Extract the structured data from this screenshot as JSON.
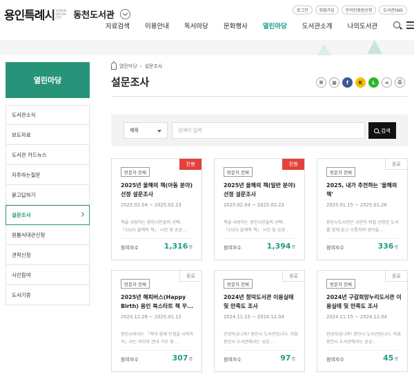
{
  "header": {
    "logo_main": "용인특례시",
    "logo_sub": "YONGIN SPECIAL CITY",
    "library": "동천도서관",
    "util": [
      "로그인",
      "회원가입",
      "온라인회원신청",
      "도서관SNS"
    ],
    "nav": [
      "자료검색",
      "이용안내",
      "독서마당",
      "문화행사",
      "열린마당",
      "도서관소개",
      "나의도서관"
    ],
    "nav_active_index": 4
  },
  "sidebar": {
    "title": "열린마당",
    "items": [
      "도서관소식",
      "보도자료",
      "도서관 카드뉴스",
      "자주하는질문",
      "묻고답하기",
      "설문조사",
      "원룸식대관신청",
      "견학신청",
      "시민참여",
      "도서기증"
    ],
    "active_index": 5
  },
  "breadcrumb": [
    "열린마당",
    "설문조사"
  ],
  "page_title": "설문조사",
  "share": [
    "link-icon",
    "qr-icon",
    "facebook-icon",
    "kakaostory-icon",
    "line-icon",
    "share-icon",
    "print-icon"
  ],
  "search": {
    "select_value": "제목",
    "placeholder": "검색어 입력",
    "button": "검색"
  },
  "cards": [
    {
      "status": "진행",
      "tag": "방문자 전체",
      "title": "2025년 올해의 책(아동 분야) 선정 설문조사",
      "date": "2025.02.04 ~ 2025.02.23",
      "desc": "책을 사랑하는 용인시민들의 선택, 「2025 올해의 책」 시민 및 공공...",
      "part_label": "참여자수",
      "count": "1,316",
      "unit": "명"
    },
    {
      "status": "진행",
      "tag": "방문자 전체",
      "title": "2025년 올해의 책(일반 분야) 선정 설문조사",
      "date": "2025.02.04 ~ 2025.02.23",
      "desc": "책을 사랑하는 용인시민들의 선택, 「2025 올해의 책」 시민 및 공공...",
      "part_label": "참여자수",
      "count": "1,394",
      "unit": "명"
    },
    {
      "status": "종료",
      "tag": "방문자 전체",
      "title": "2025, 내가 추천하는 '올해의 책'",
      "date": "2025.01.15 ~ 2025.01.26",
      "desc": "용인시도서관은 시민이 직접 선정한 도서를 함께 읽고 소통하며 생각을...",
      "part_label": "참여자수",
      "count": "336",
      "unit": "명"
    },
    {
      "status": "종료",
      "tag": "방문자 전체",
      "title": "2025년 해피버스(Happy Birth) 용인 북스타트 책 꾸...",
      "date": "2024.12.26 ~ 2025.01.12",
      "desc": "용인시에서는 「책과 함께 인생을 시작하자」라는 의미로 관내 거주 영...",
      "part_label": "참여자수",
      "count": "307",
      "unit": "명"
    },
    {
      "status": "종료",
      "tag": "방문자 전체",
      "title": "2024년 청덕도서관 이용실태 및 만족도 조사",
      "date": "2024.11.15 ~ 2024.12.04",
      "desc": "안녕하십니까? 용인시 도서관입니다. 저희 용인시 도서관에서는 공공...",
      "part_label": "참여자수",
      "count": "97",
      "unit": "명"
    },
    {
      "status": "종료",
      "tag": "방문자 전체",
      "title": "2024년 구갈희망누리도서관 이용실태 및 만족도 조사",
      "date": "2024.11.15 ~ 2024.12.04",
      "desc": "안녕하십니까? 용인시 도서관입니다. 저희 용인시 도서관에서는 공공...",
      "part_label": "참여자수",
      "count": "45",
      "unit": "명"
    }
  ]
}
